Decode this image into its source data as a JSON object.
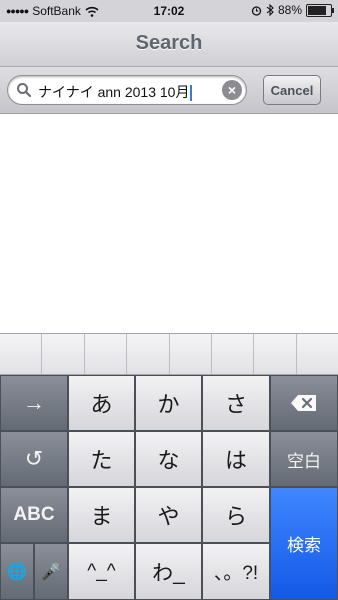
{
  "status_bar": {
    "signal": "●●●●●",
    "carrier": "SoftBank",
    "wifi_icon": "wifi-icon",
    "time": "17:02",
    "alarm_icon": "alarm-icon",
    "bluetooth_icon": "bluetooth-icon",
    "battery_text": "88%",
    "battery_level": 0.88
  },
  "nav": {
    "title": "Search"
  },
  "search": {
    "value": "ナイナイ ann 2013 10月",
    "cancel_label": "Cancel",
    "clear_glyph": "×"
  },
  "keyboard": {
    "row1": {
      "arrow": "→",
      "k1": "あ",
      "k2": "か",
      "k3": "さ",
      "delete_glyph": "⌫"
    },
    "row2": {
      "undo": "↺",
      "k1": "た",
      "k2": "な",
      "k3": "は",
      "space": "空白"
    },
    "row3": {
      "abc": "ABC",
      "k1": "ま",
      "k2": "や",
      "k3": "ら",
      "search": "検索"
    },
    "row4": {
      "globe": "🌐",
      "mic": "🎤",
      "k1": "^_^",
      "k2": "わ_",
      "k3": "、。?!"
    }
  },
  "colors": {
    "accent": "#1459e6",
    "caret": "#3a7bd5"
  }
}
